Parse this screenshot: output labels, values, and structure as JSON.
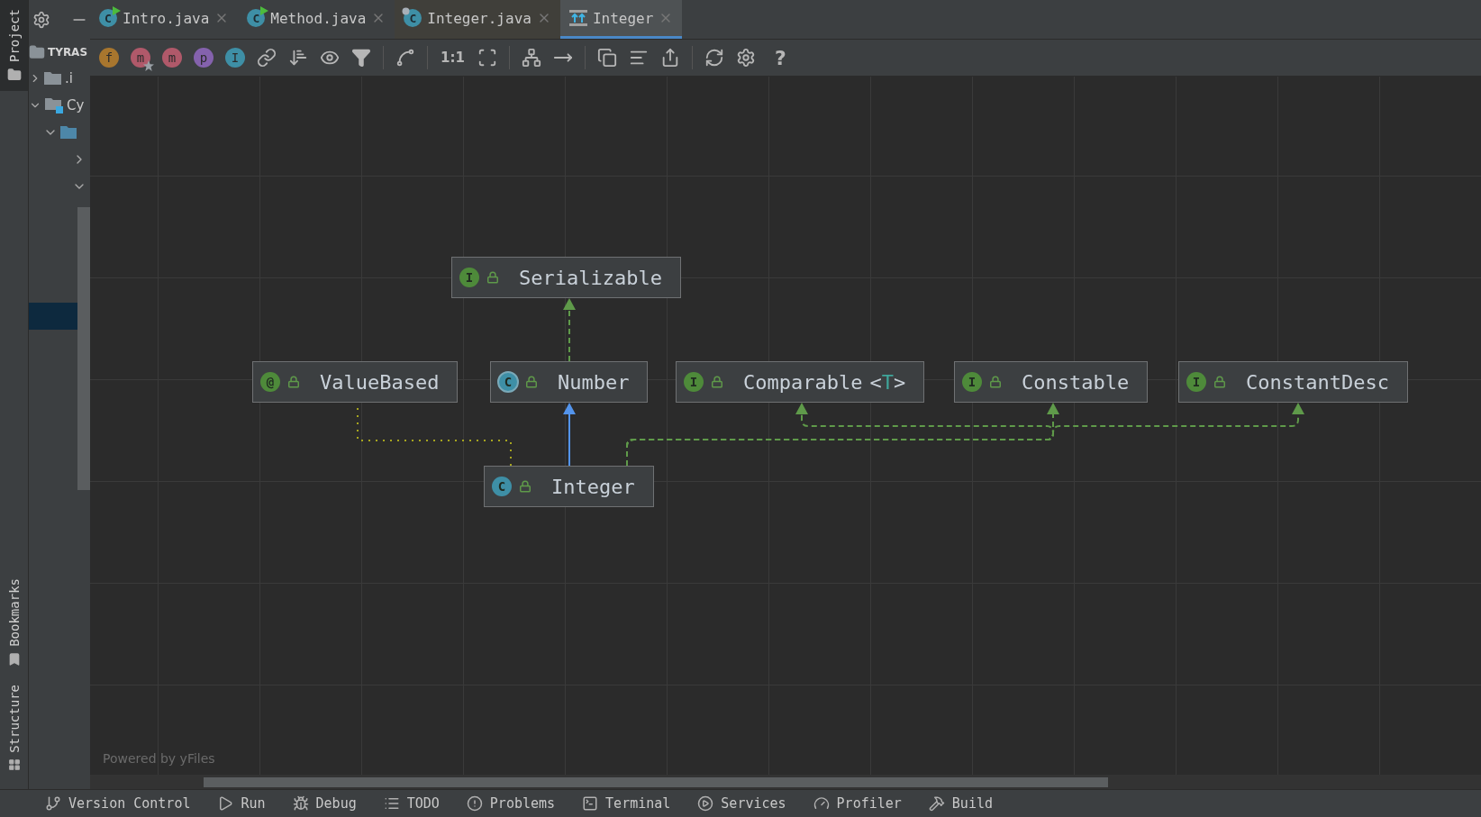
{
  "tool_strip": {
    "top": [
      {
        "label": "Project",
        "selected": true
      }
    ],
    "bottom": [
      {
        "label": "Bookmarks",
        "selected": false
      },
      {
        "label": "Structure",
        "selected": false
      }
    ]
  },
  "project_panel": {
    "title": "TYRAS",
    "rows": [
      {
        "label": ".i",
        "expanded": false,
        "kind": "folder"
      },
      {
        "label": "Cy",
        "expanded": true,
        "kind": "module"
      }
    ]
  },
  "tabs": [
    {
      "label": "Intro.java",
      "icon_letter": "C",
      "kind": "runnable",
      "selected": false
    },
    {
      "label": "Method.java",
      "icon_letter": "C",
      "kind": "runnable",
      "selected": false
    },
    {
      "label": "Integer.java",
      "icon_letter": "C",
      "kind": "library",
      "selected": false
    },
    {
      "label": "Integer",
      "kind": "diagram",
      "selected": true
    }
  ],
  "toolbar": {
    "filters": [
      {
        "letter": "f",
        "color": "#a8762e",
        "kind": "plain"
      },
      {
        "letter": "m",
        "color": "#b0596a",
        "kind": "star"
      },
      {
        "letter": "m",
        "color": "#b0596a",
        "kind": "plain"
      },
      {
        "letter": "p",
        "color": "#8462ad",
        "kind": "plain"
      },
      {
        "letter": "I",
        "color": "#3e8fa6",
        "kind": "plain"
      }
    ],
    "actual_size": "1:1",
    "help": "?"
  },
  "diagram": {
    "nodes": [
      {
        "name": "Serializable",
        "badge": "I",
        "kind": "interface",
        "color": "#4e8a3a"
      },
      {
        "name": "ValueBased",
        "badge": "@",
        "kind": "annotation",
        "color": "#4e8a3a"
      },
      {
        "name": "Number",
        "badge": "C",
        "kind": "abstract_class",
        "color": "#3e8fa6"
      },
      {
        "name": "Comparable",
        "badge": "I",
        "kind": "interface",
        "color": "#4e8a3a",
        "type_parameter": {
          "open": "<",
          "name": "T",
          "close": ">"
        }
      },
      {
        "name": "Constable",
        "badge": "I",
        "kind": "interface",
        "color": "#4e8a3a"
      },
      {
        "name": "ConstantDesc",
        "badge": "I",
        "kind": "interface",
        "color": "#4e8a3a"
      },
      {
        "name": "Integer",
        "badge": "C",
        "kind": "class",
        "color": "#3e8fa6"
      }
    ],
    "edges": [
      {
        "kind": "implements"
      },
      {
        "kind": "extends"
      },
      {
        "kind": "annotation"
      },
      {
        "kind": "implements"
      },
      {
        "kind": "implements"
      },
      {
        "kind": "implements"
      }
    ],
    "footer": "Powered by yFiles"
  },
  "bottom_bar": [
    {
      "label": "Version Control",
      "kind": "vcs"
    },
    {
      "label": "Run",
      "kind": "run"
    },
    {
      "label": "Debug",
      "kind": "debug"
    },
    {
      "label": "TODO",
      "kind": "todo"
    },
    {
      "label": "Problems",
      "kind": "problems"
    },
    {
      "label": "Terminal",
      "kind": "terminal"
    },
    {
      "label": "Services",
      "kind": "services"
    },
    {
      "label": "Profiler",
      "kind": "profiler"
    },
    {
      "label": "Build",
      "kind": "build"
    }
  ]
}
